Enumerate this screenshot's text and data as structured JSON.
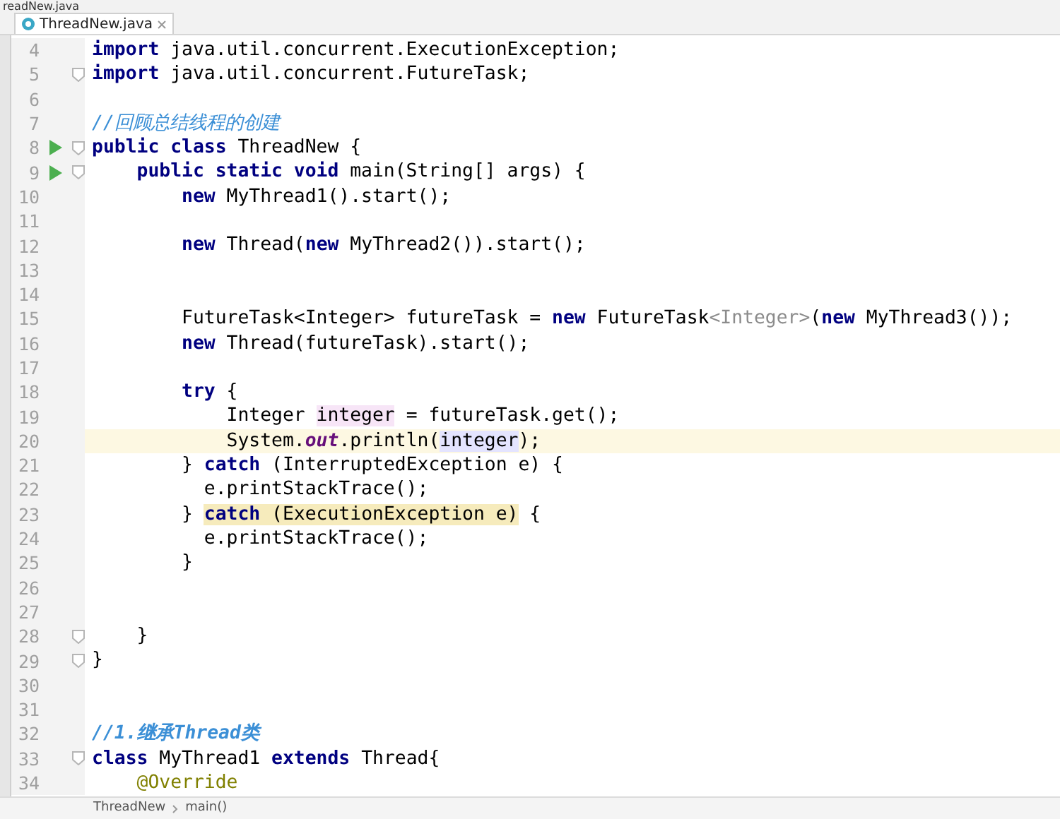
{
  "path_crumb": "readNew.java",
  "tab": {
    "label": "ThreadNew.java",
    "selected": true
  },
  "lines": [
    {
      "number": "4",
      "run": false,
      "fold": false,
      "current": false,
      "tokens": [
        {
          "kind": "kw",
          "t": "import"
        },
        {
          "kind": "p",
          "t": " java.util.concurrent.ExecutionException;"
        }
      ]
    },
    {
      "number": "5",
      "run": false,
      "fold": true,
      "current": false,
      "tokens": [
        {
          "kind": "kw",
          "t": "import"
        },
        {
          "kind": "p",
          "t": " java.util.concurrent.FutureTask;"
        }
      ]
    },
    {
      "number": "6",
      "run": false,
      "fold": false,
      "current": false
    },
    {
      "number": "7",
      "run": false,
      "fold": false,
      "current": false,
      "tokens": [
        {
          "kind": "cm",
          "t": "//回顾总结线程的创建"
        }
      ]
    },
    {
      "number": "8",
      "run": true,
      "fold": true,
      "current": false,
      "tokens": [
        {
          "kind": "kw",
          "t": "public class"
        },
        {
          "kind": "p",
          "t": " ThreadNew {"
        }
      ]
    },
    {
      "number": "9",
      "run": true,
      "fold": true,
      "current": false,
      "tokens": [
        {
          "kind": "kw",
          "t": "    public static void"
        },
        {
          "kind": "p",
          "t": " main(String[] args) {"
        }
      ]
    },
    {
      "number": "10",
      "run": false,
      "fold": false,
      "current": false,
      "tokens": [
        {
          "kind": "kw",
          "t": "        new"
        },
        {
          "kind": "p",
          "t": " MyThread1().start();"
        }
      ]
    },
    {
      "number": "11",
      "run": false,
      "fold": false,
      "current": false
    },
    {
      "number": "12",
      "run": false,
      "fold": false,
      "current": false,
      "tokens": [
        {
          "kind": "kw",
          "t": "        new"
        },
        {
          "kind": "p",
          "t": " Thread("
        },
        {
          "kind": "kw",
          "t": "new"
        },
        {
          "kind": "p",
          "t": " MyThread2()).start();"
        }
      ]
    },
    {
      "number": "13",
      "run": false,
      "fold": false,
      "current": false
    },
    {
      "number": "14",
      "run": false,
      "fold": false,
      "current": false
    },
    {
      "number": "15",
      "run": false,
      "fold": false,
      "current": false,
      "tokens": [
        {
          "kind": "p",
          "t": "        FutureTask<Integer> futureTask = "
        },
        {
          "kind": "kw",
          "t": "new"
        },
        {
          "kind": "p",
          "t": " FutureTask"
        },
        {
          "kind": "gen",
          "t": "<Integer>"
        },
        {
          "kind": "p",
          "t": "("
        },
        {
          "kind": "kw",
          "t": "new"
        },
        {
          "kind": "p",
          "t": " MyThread3());"
        }
      ]
    },
    {
      "number": "16",
      "run": false,
      "fold": false,
      "current": false,
      "tokens": [
        {
          "kind": "kw",
          "t": "        new"
        },
        {
          "kind": "p",
          "t": " Thread(futureTask).start();"
        }
      ]
    },
    {
      "number": "17",
      "run": false,
      "fold": false,
      "current": false
    },
    {
      "number": "18",
      "run": false,
      "fold": false,
      "current": false,
      "tokens": [
        {
          "kind": "kw",
          "t": "        try"
        },
        {
          "kind": "p",
          "t": " {"
        }
      ]
    },
    {
      "number": "19",
      "run": false,
      "fold": false,
      "current": false,
      "tokens": [
        {
          "kind": "p",
          "t": "            Integer "
        },
        {
          "kind": "def",
          "t": "integer"
        },
        {
          "kind": "p",
          "t": " = futureTask.get();"
        }
      ]
    },
    {
      "number": "20",
      "run": false,
      "fold": false,
      "current": true,
      "tokens": [
        {
          "kind": "p",
          "t": "            System."
        },
        {
          "kind": "field",
          "t": "out"
        },
        {
          "kind": "p",
          "t": ".println("
        },
        {
          "kind": "use",
          "t": "integer"
        },
        {
          "kind": "p",
          "t": ");"
        }
      ]
    },
    {
      "number": "21",
      "run": false,
      "fold": false,
      "current": false,
      "tokens": [
        {
          "kind": "p",
          "t": "        } "
        },
        {
          "kind": "kw",
          "t": "catch"
        },
        {
          "kind": "p",
          "t": " (InterruptedException e) {"
        }
      ]
    },
    {
      "number": "22",
      "run": false,
      "fold": false,
      "current": false,
      "tokens": [
        {
          "kind": "p",
          "t": "          e.printStackTrace();"
        }
      ]
    },
    {
      "number": "23",
      "run": false,
      "fold": false,
      "current": false,
      "tokens": [
        {
          "kind": "p",
          "t": "        } "
        },
        {
          "kind": "kwwarn",
          "t": "catch"
        },
        {
          "kind": "warn",
          "t": " (ExecutionException e)"
        },
        {
          "kind": "p",
          "t": " {"
        }
      ]
    },
    {
      "number": "24",
      "run": false,
      "fold": false,
      "current": false,
      "tokens": [
        {
          "kind": "p",
          "t": "          e.printStackTrace();"
        }
      ]
    },
    {
      "number": "25",
      "run": false,
      "fold": false,
      "current": false,
      "tokens": [
        {
          "kind": "p",
          "t": "        }"
        }
      ]
    },
    {
      "number": "26",
      "run": false,
      "fold": false,
      "current": false
    },
    {
      "number": "27",
      "run": false,
      "fold": false,
      "current": false
    },
    {
      "number": "28",
      "run": false,
      "fold": true,
      "current": false,
      "tokens": [
        {
          "kind": "p",
          "t": "    }"
        }
      ]
    },
    {
      "number": "29",
      "run": false,
      "fold": true,
      "current": false,
      "tokens": [
        {
          "kind": "p",
          "t": "}"
        }
      ]
    },
    {
      "number": "30",
      "run": false,
      "fold": false,
      "current": false
    },
    {
      "number": "31",
      "run": false,
      "fold": false,
      "current": false
    },
    {
      "number": "32",
      "run": false,
      "fold": false,
      "current": false,
      "tokens": [
        {
          "kind": "cmb",
          "t": "//1.继承Thread类"
        }
      ]
    },
    {
      "number": "33",
      "run": false,
      "fold": true,
      "current": false,
      "tokens": [
        {
          "kind": "kw",
          "t": "class"
        },
        {
          "kind": "p",
          "t": " MyThread1 "
        },
        {
          "kind": "kw",
          "t": "extends"
        },
        {
          "kind": "p",
          "t": " Thread{"
        }
      ]
    },
    {
      "number": "34",
      "run": false,
      "fold": false,
      "current": false,
      "tokens": [
        {
          "kind": "ann",
          "t": "    @Override"
        }
      ]
    }
  ],
  "breadcrumb": [
    "ThreadNew",
    "main()"
  ]
}
